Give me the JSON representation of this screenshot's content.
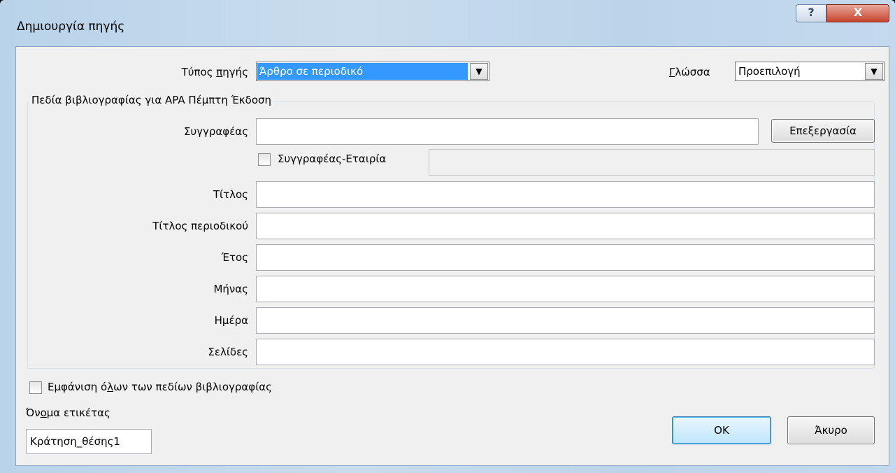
{
  "dialog": {
    "title": "Δημιουργία πηγής",
    "help_glyph": "?",
    "close_glyph": "X"
  },
  "source_type": {
    "label_pre": "Τύπος ",
    "label_key": "π",
    "label_post": "ηγής",
    "value": "Άρθρο σε περιοδικό"
  },
  "language": {
    "label_key": "Γ",
    "label_post": "λώσσα",
    "value": "Προεπιλογή"
  },
  "fields_group": {
    "title": "Πεδία βιβλιογραφίας για APA Πέμπτη Έκδοση",
    "author_label": "Συγγραφέας",
    "author_value": "",
    "edit_button": "Επεξεργασία",
    "corporate_author_label": "Συγγραφέας-Εταιρία",
    "corporate_author_checked": false,
    "corporate_author_value": "",
    "rows": [
      {
        "label": "Τίτλος",
        "value": ""
      },
      {
        "label": "Τίτλος περιοδικού",
        "value": ""
      },
      {
        "label": "Έτος",
        "value": ""
      },
      {
        "label": "Μήνας",
        "value": ""
      },
      {
        "label": "Ημέρα",
        "value": ""
      },
      {
        "label": "Σελίδες",
        "value": ""
      }
    ]
  },
  "show_all": {
    "label_pre": "Εμφάνιση ό",
    "label_key": "λ",
    "label_post": "ων των πεδίων βιβλιογραφίας",
    "checked": false
  },
  "tag_name": {
    "label_pre": "Όν",
    "label_key": "ο",
    "label_post": "μα ετικέτας",
    "value": "Κράτηση_θέσης1"
  },
  "buttons": {
    "ok": "OK",
    "cancel": "Άκυρο"
  }
}
